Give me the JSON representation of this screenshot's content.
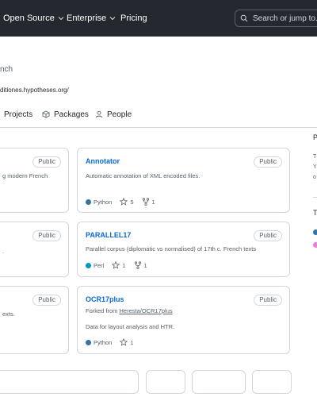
{
  "header": {
    "nav": [
      {
        "label": "Open Source",
        "has_caret": true
      },
      {
        "label": "Enterprise",
        "has_caret": true
      },
      {
        "label": "Pricing",
        "has_caret": false
      }
    ],
    "search_placeholder": "Search or jump to...",
    "search_icon": "search-icon"
  },
  "org": {
    "description_fragment": "nch",
    "link_fragment": "ditiones.hypotheses.org/"
  },
  "tabs": [
    {
      "label": "Projects",
      "icon": "table-icon"
    },
    {
      "label": "Packages",
      "icon": "package-icon"
    },
    {
      "label": "People",
      "icon": "person-icon"
    }
  ],
  "left_cards": [
    {
      "badge": "Public",
      "desc_fragment": "g modern French"
    },
    {
      "badge": "Public",
      "desc_fragment": "."
    },
    {
      "badge": "Public",
      "desc_fragment": "exts."
    }
  ],
  "repos": [
    {
      "name": "Annotator",
      "badge": "Public",
      "description": "Automatic annotation of XML encoded files.",
      "language": "Python",
      "language_color": "#3572A5",
      "stars": "5",
      "forks": "1"
    },
    {
      "name": "PARALLEL17",
      "badge": "Public",
      "description": "Parallel corpus (diplomatic vs normalised) of 17th c. French texts",
      "language": "Perl",
      "language_color": "#0298c3",
      "stars": "1",
      "forks": "1"
    },
    {
      "name": "OCR17plus",
      "badge": "Public",
      "forked_prefix": "Forked from ",
      "forked_from": "Heresta/OCR17plus",
      "description": "Data for layout analysis and HTR.",
      "language": "Python",
      "language_color": "#3572A5",
      "stars": "1"
    }
  ],
  "sidebar": {
    "heading1": "P",
    "lines": [
      "T",
      "Y",
      "o"
    ],
    "heading2": "T",
    "dot_colors": [
      "#3572A5",
      "#e87fd9"
    ]
  }
}
